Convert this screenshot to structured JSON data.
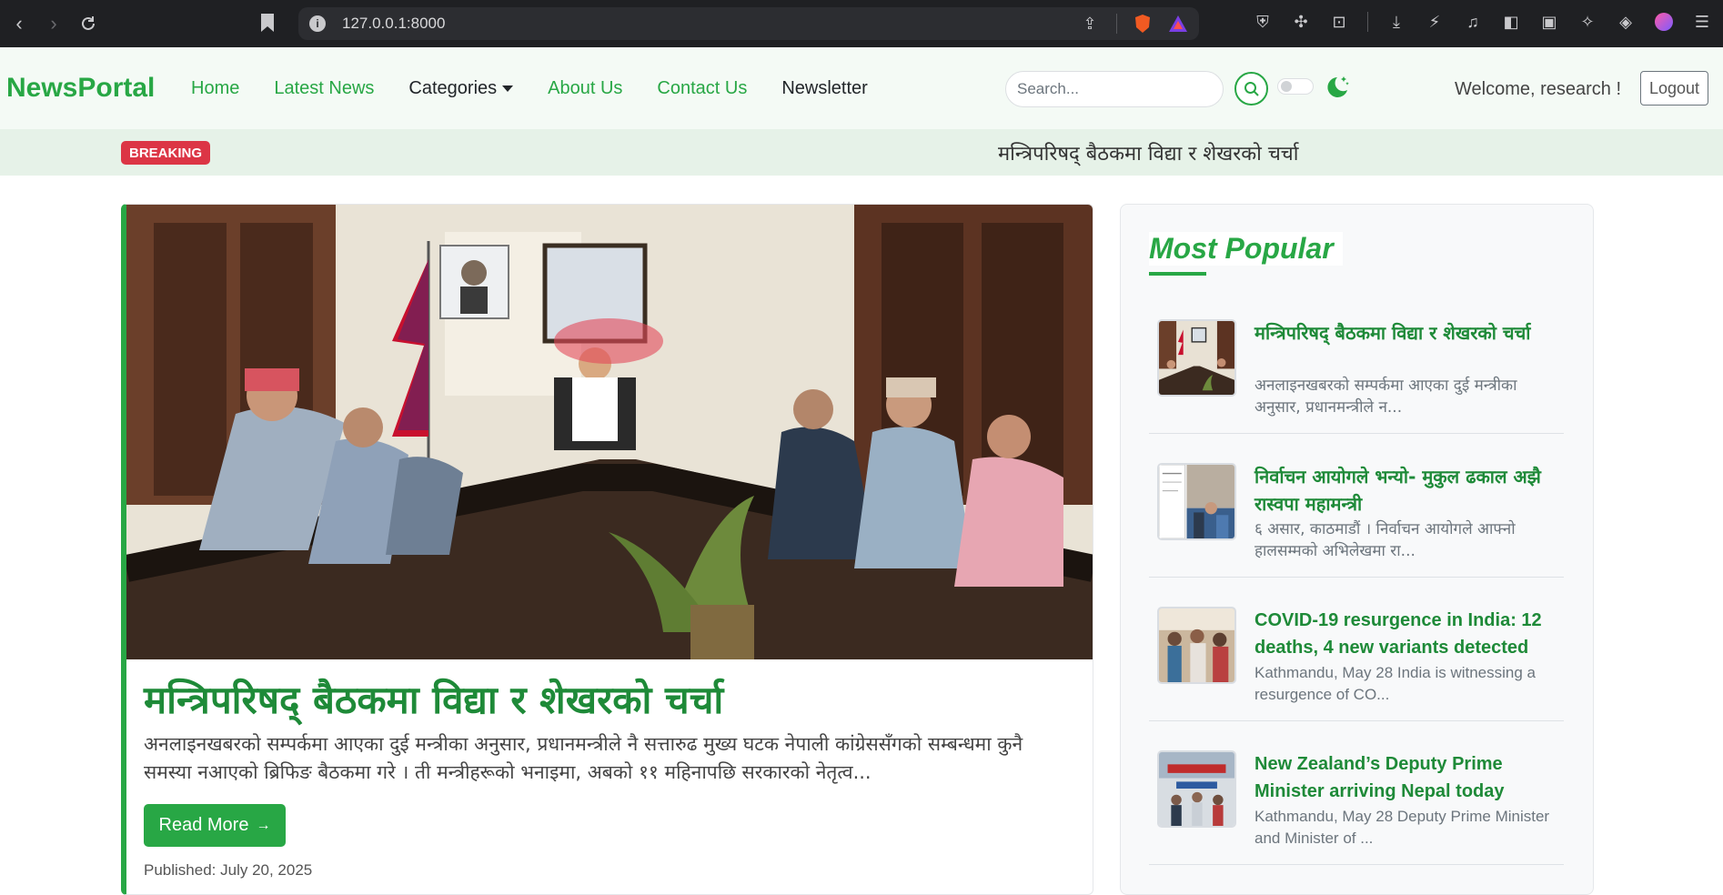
{
  "browser": {
    "url": "127.0.0.1:8000"
  },
  "navbar": {
    "brand": "NewsPortal",
    "links": [
      "Home",
      "Latest News",
      "Categories",
      "About Us",
      "Contact Us",
      "Newsletter"
    ],
    "search_placeholder": "Search...",
    "welcome": "Welcome, research !",
    "logout": "Logout"
  },
  "breaking": {
    "badge": "BREAKING",
    "text": "मन्त्रिपरिषद् बैठकमा विद्या र शेखरको चर्चा"
  },
  "featured": {
    "title": "मन्त्रिपरिषद् बैठकमा विद्या र शेखरको चर्चा",
    "summary": "अनलाइनखबरको सम्पर्कमा आएका दुई मन्त्रीका अनुसार, प्रधानमन्त्रीले नै सत्तारुढ मुख्य घटक नेपाली कांग्रेससँगको सम्बन्धमा कुनै समस्या नआएको ब्रिफिङ बैठकमा गरे । ती मन्त्रीहरूको भनाइमा, अबको ११ महिनापछि सरकारको नेतृत्व...",
    "read_more": "Read More",
    "published": "Published: July 20, 2025"
  },
  "sidebar": {
    "title": "Most Popular",
    "items": [
      {
        "title": "मन्त्रिपरिषद् बैठकमा विद्या र शेखरको चर्चा",
        "excerpt": "अनलाइनखबरको सम्पर्कमा आएका दुई मन्त्रीका अनुसार, प्रधानमन्त्रीले न..."
      },
      {
        "title": "निर्वाचन आयोगले भन्यो- मुकुल ढकाल अझै रास्वपा महामन्त्री",
        "excerpt": "६ असार, काठमाडौं । निर्वाचन आयोगले आफ्नो हालसम्मको अभिलेखमा रा..."
      },
      {
        "title": "COVID-19 resurgence in India: 12 deaths, 4 new variants detected",
        "excerpt": "Kathmandu, May 28 India is witnessing a resurgence of CO..."
      },
      {
        "title": "New Zealand’s Deputy Prime Minister arriving Nepal today",
        "excerpt": "Kathmandu, May 28 Deputy Prime Minister and Minister of ..."
      }
    ]
  },
  "colors": {
    "brand_green": "#28a745",
    "breaking_red": "#dc3545"
  }
}
